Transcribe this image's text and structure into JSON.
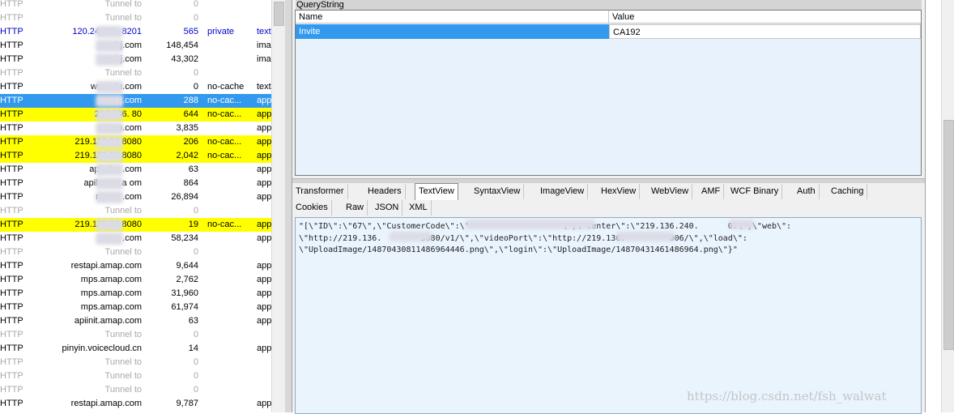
{
  "sessions": [
    {
      "protocol": "HTTP",
      "host": "Tunnel to",
      "size": "0",
      "caching": "",
      "type": "",
      "style": "tunnel"
    },
    {
      "protocol": "HTTP",
      "host": "Tunnel to",
      "size": "0",
      "caching": "",
      "type": "",
      "style": "tunnel"
    },
    {
      "protocol": "HTTP",
      "host": "120.24.221.   8201",
      "size": "565",
      "caching": "private",
      "type": "text",
      "style": "blue"
    },
    {
      "protocol": "HTTP",
      "host": "ap      kj.com",
      "size": "148,454",
      "caching": "",
      "type": "imag",
      "style": ""
    },
    {
      "protocol": "HTTP",
      "host": "ap      kj.com",
      "size": "43,302",
      "caching": "",
      "type": "imag",
      "style": ""
    },
    {
      "protocol": "HTTP",
      "host": "Tunnel to",
      "size": "0",
      "caching": "",
      "type": "",
      "style": "tunnel"
    },
    {
      "protocol": "HTTP",
      "host": "www      du.com",
      "size": "0",
      "caching": "no-cache",
      "type": "text",
      "style": ""
    },
    {
      "protocol": "HTTP",
      "host": "ap      kj.com",
      "size": "288",
      "caching": "no-cac...",
      "type": "app",
      "style": "selected"
    },
    {
      "protocol": "HTTP",
      "host": "219.136.      80",
      "size": "644",
      "caching": "no-cac...",
      "type": "app",
      "style": "yellow"
    },
    {
      "protocol": "HTTP",
      "host": "mps      p.com",
      "size": "3,835",
      "caching": "",
      "type": "app",
      "style": ""
    },
    {
      "protocol": "HTTP",
      "host": "219.136.24   8080",
      "size": "206",
      "caching": "no-cac...",
      "type": "app",
      "style": "yellow"
    },
    {
      "protocol": "HTTP",
      "host": "219.136.24   8080",
      "size": "2,042",
      "caching": "no-cac...",
      "type": "app",
      "style": "yellow"
    },
    {
      "protocol": "HTTP",
      "host": "apiinit.a     .com",
      "size": "63",
      "caching": "",
      "type": "app",
      "style": ""
    },
    {
      "protocol": "HTTP",
      "host": "apilocate.a     om",
      "size": "864",
      "caching": "",
      "type": "app",
      "style": ""
    },
    {
      "protocol": "HTTP",
      "host": "mps.a     .com",
      "size": "26,894",
      "caching": "",
      "type": "app",
      "style": ""
    },
    {
      "protocol": "HTTP",
      "host": "Tunnel to",
      "size": "0",
      "caching": "",
      "type": "",
      "style": "tunnel"
    },
    {
      "protocol": "HTTP",
      "host": "219.136.24   8080",
      "size": "19",
      "caching": "no-cac...",
      "type": "app",
      "style": "yellow"
    },
    {
      "protocol": "HTTP",
      "host": "mps.     .com",
      "size": "58,234",
      "caching": "",
      "type": "app",
      "style": ""
    },
    {
      "protocol": "HTTP",
      "host": "Tunnel to",
      "size": "0",
      "caching": "",
      "type": "",
      "style": "tunnel"
    },
    {
      "protocol": "HTTP",
      "host": "restapi.amap.com",
      "size": "9,644",
      "caching": "",
      "type": "app",
      "style": ""
    },
    {
      "protocol": "HTTP",
      "host": "mps.amap.com",
      "size": "2,762",
      "caching": "",
      "type": "app",
      "style": ""
    },
    {
      "protocol": "HTTP",
      "host": "mps.amap.com",
      "size": "31,960",
      "caching": "",
      "type": "app",
      "style": ""
    },
    {
      "protocol": "HTTP",
      "host": "mps.amap.com",
      "size": "61,974",
      "caching": "",
      "type": "app",
      "style": ""
    },
    {
      "protocol": "HTTP",
      "host": "apiinit.amap.com",
      "size": "63",
      "caching": "",
      "type": "app",
      "style": ""
    },
    {
      "protocol": "HTTP",
      "host": "Tunnel to",
      "size": "0",
      "caching": "",
      "type": "",
      "style": "tunnel"
    },
    {
      "protocol": "HTTP",
      "host": "pinyin.voicecloud.cn",
      "size": "14",
      "caching": "",
      "type": "app",
      "style": ""
    },
    {
      "protocol": "HTTP",
      "host": "Tunnel to",
      "size": "0",
      "caching": "",
      "type": "",
      "style": "tunnel"
    },
    {
      "protocol": "HTTP",
      "host": "Tunnel to",
      "size": "0",
      "caching": "",
      "type": "",
      "style": "tunnel"
    },
    {
      "protocol": "HTTP",
      "host": "Tunnel to",
      "size": "0",
      "caching": "",
      "type": "",
      "style": "tunnel"
    },
    {
      "protocol": "HTTP",
      "host": "restapi.amap.com",
      "size": "9,787",
      "caching": "",
      "type": "app",
      "style": ""
    }
  ],
  "querystring": {
    "title": "QueryString",
    "headers": {
      "name": "Name",
      "value": "Value"
    },
    "rows": [
      {
        "name": "Invite",
        "value": "CA192"
      }
    ]
  },
  "response_tabs": {
    "row1": [
      "Transformer",
      "Headers",
      "TextView",
      "SyntaxView",
      "ImageView",
      "HexView",
      "WebView",
      "AMF",
      "WCF Binary",
      "Auth",
      "Caching"
    ],
    "row2": [
      "Cookies",
      "Raw",
      "JSON",
      "XML"
    ],
    "active": "TextView"
  },
  "textview_lines": [
    "\"[\\\"ID\\\":\\\"67\\\",\\\"CustomerCode\\\":\\\"                   \\\",\\\"center\\\":\\\"219.136.240.      07\\\",\\\"web\\\":",
    "\\\"http://219.136.        3080/v1/\\\",\\\"videoPort\\\":\\\"http://219.136.         006/\\\",\\\"load\\\":",
    "\\\"UploadImage/14870430811486964446.png\\\",\\\"login\\\":\\\"UploadImage/14870431461486964.png\\\"}\""
  ],
  "watermark": "https://blog.csdn.net/fsh_walwat",
  "colors": {
    "selected": "#3399ee",
    "highlight": "#ffff00",
    "tunnel": "#a8a8a8",
    "link": "#0000cc",
    "textview_bg": "#eaf4fc"
  }
}
